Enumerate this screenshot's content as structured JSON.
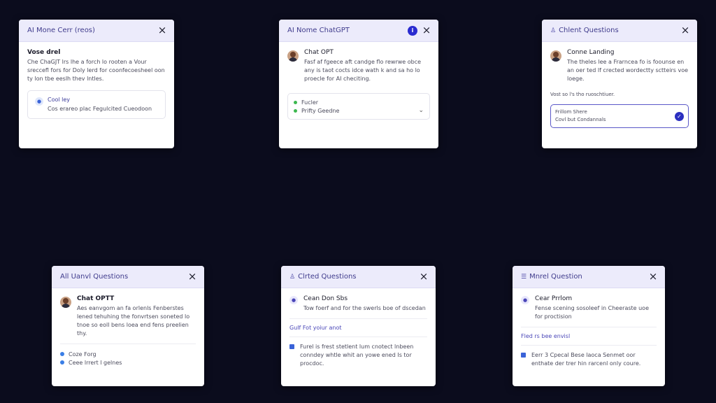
{
  "cards": [
    {
      "title": "AI Mone Cerr (reos)",
      "heading": "Vose drel",
      "body": "Che ChaGJT lrs lhe a forch lo rooten a Vour sreccefl fors for Doly lerd for coonfecoesheel oon ty lon tbe eeslh thev lntles.",
      "sub_title": "Cool ley",
      "sub_text": "Cos erareo plac Fegulcited Cueodoon"
    },
    {
      "title": "AI Nome ChatGPT",
      "badge": "i",
      "name": "Chat OPT",
      "body": "Fasf af fgeece aft candge flo rewrwe obce any is taot cocts idce wath k and sa ho lo proecle for AI checiting.",
      "options": [
        "Fucler",
        "Prifty Geedne"
      ]
    },
    {
      "title": "Chlent Questions",
      "name": "Conne Landing",
      "body": "The theles lee a Frarncea fo is foounse en an oer ted lf crected wordectty sctteirs voe loege.",
      "note": "Vost so l's tho ruoschtiuer.",
      "select_line1": "Frillom Shere",
      "select_line2": "Covl but Condannals"
    },
    {
      "title": "All Uanvl Questions",
      "name": "Chat OPTT",
      "body": "Aes eanvgom an fa orlenls Fenberstes lened tehuhing the fonvrtsen soneted lo tnoe so eoll bens loea end fens preelien thy.",
      "options": [
        "Coze Forg",
        "Ceee lrrert l gelnes"
      ]
    },
    {
      "title": "Clrted Questions",
      "name": "Cean Don Sbs",
      "body": "Tow foerf and for the swerls boe of dscedan",
      "link": "Gulf Fot yoiur anot",
      "footer": "Furel is frest stetlent lum cnotect lnbeen conndey whtle whit an yowe ened Is tor procdoc."
    },
    {
      "title": "Mnrel Question",
      "name": "Cear Prrlom",
      "body": "Fense scening sosoleef in Cheeraste uoe for proctision",
      "link": "Fled rs bee envisl",
      "footer": "Eerr 3 Cpecal Bese laoca Senmet oor enthate der trer hin rarcenl only coure."
    }
  ]
}
